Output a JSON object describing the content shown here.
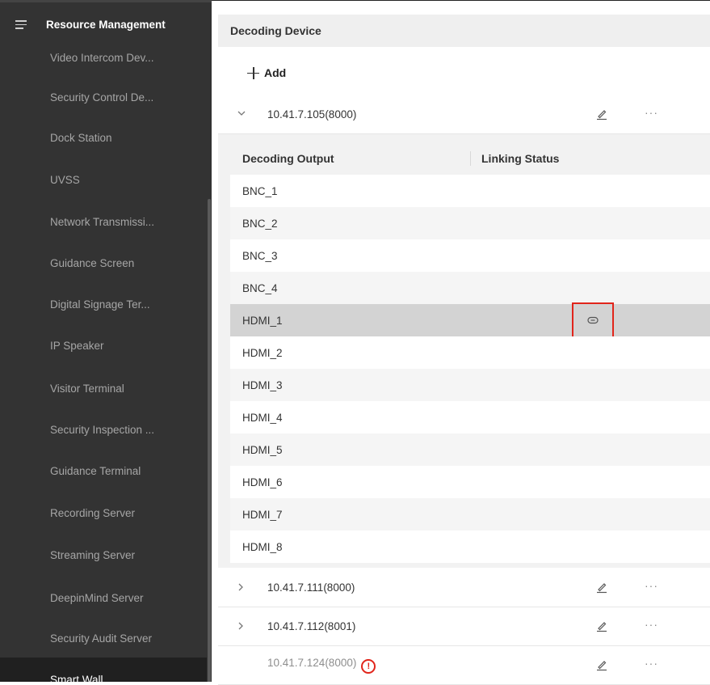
{
  "sidebar": {
    "title": "Resource Management",
    "items": [
      {
        "label": "Video Intercom Dev..."
      },
      {
        "label": "Security Control De..."
      },
      {
        "label": "Dock Station"
      },
      {
        "label": "UVSS"
      },
      {
        "label": "Network Transmissi..."
      },
      {
        "label": "Guidance Screen"
      },
      {
        "label": "Digital Signage Ter..."
      },
      {
        "label": "IP Speaker"
      },
      {
        "label": "Visitor Terminal"
      },
      {
        "label": "Security Inspection ..."
      },
      {
        "label": "Guidance Terminal"
      },
      {
        "label": "Recording Server"
      },
      {
        "label": "Streaming Server"
      },
      {
        "label": "DeepinMind Server"
      },
      {
        "label": "Security Audit Server"
      },
      {
        "label": "Smart Wall"
      }
    ]
  },
  "main": {
    "section_title": "Decoding Device",
    "add_label": "Add",
    "devices": [
      {
        "name": "10.41.7.105(8000)",
        "expanded": true
      },
      {
        "name": "10.41.7.111(8000)",
        "expanded": false
      },
      {
        "name": "10.41.7.112(8001)",
        "expanded": false
      },
      {
        "name": "10.41.7.124(8000)",
        "offline": true,
        "warning": "!"
      }
    ],
    "table": {
      "col_output": "Decoding Output",
      "col_status": "Linking Status",
      "rows": [
        "BNC_1",
        "BNC_2",
        "BNC_3",
        "BNC_4",
        "HDMI_1",
        "HDMI_2",
        "HDMI_3",
        "HDMI_4",
        "HDMI_5",
        "HDMI_6",
        "HDMI_7",
        "HDMI_8"
      ],
      "selected_row": "HDMI_1"
    },
    "more_glyph": "···"
  },
  "colors": {
    "sidebar_bg": "#333333",
    "highlight_red": "#e1251b",
    "selected_row": "#d3d3d3"
  }
}
